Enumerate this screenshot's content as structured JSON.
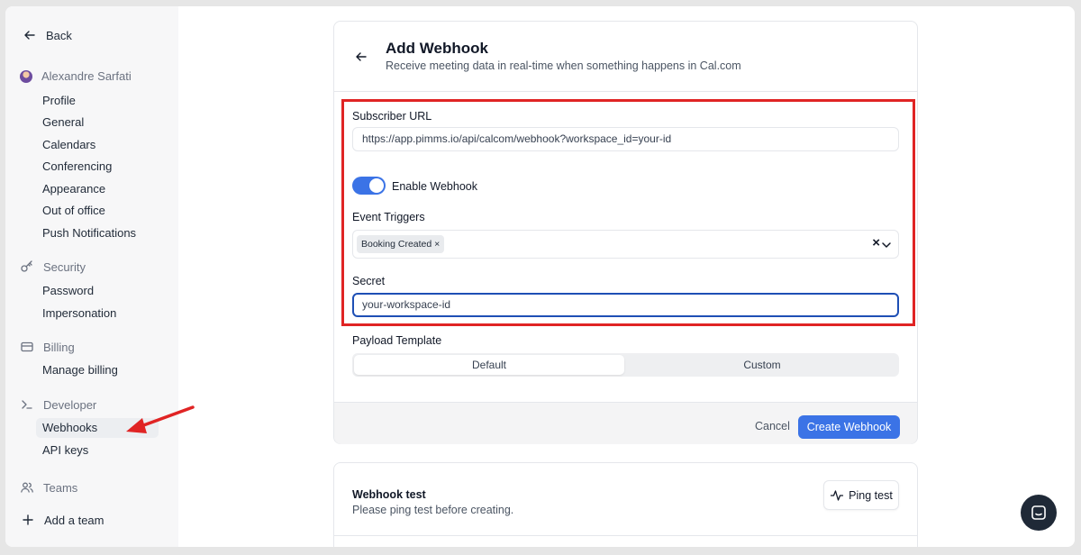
{
  "sidebar": {
    "back_label": "Back",
    "user_name": "Alexandre Sarfati",
    "account_items": [
      "Profile",
      "General",
      "Calendars",
      "Conferencing",
      "Appearance",
      "Out of office",
      "Push Notifications"
    ],
    "security_label": "Security",
    "security_items": [
      "Password",
      "Impersonation"
    ],
    "billing_label": "Billing",
    "billing_items": [
      "Manage billing"
    ],
    "developer_label": "Developer",
    "developer_items": [
      "Webhooks",
      "API keys"
    ],
    "teams_label": "Teams",
    "add_team_label": "Add a team"
  },
  "header": {
    "title": "Add Webhook",
    "subtitle": "Receive meeting data in real-time when something happens in Cal.com"
  },
  "form": {
    "subscriber_url_label": "Subscriber URL",
    "subscriber_url_value": "https://app.pimms.io/api/calcom/webhook?workspace_id=your-id",
    "enable_label": "Enable Webhook",
    "enabled": true,
    "event_triggers_label": "Event Triggers",
    "selected_trigger": "Booking Created",
    "secret_label": "Secret",
    "secret_value": "your-workspace-id",
    "payload_label": "Payload Template",
    "payload_options": [
      "Default",
      "Custom"
    ],
    "payload_selected": "Default"
  },
  "actions": {
    "cancel_label": "Cancel",
    "create_label": "Create Webhook"
  },
  "webhook_test": {
    "title": "Webhook test",
    "subtitle": "Please ping test before creating.",
    "ping_label": "Ping test"
  },
  "colors": {
    "accent": "#3b73e6",
    "highlight": "#e02424"
  }
}
